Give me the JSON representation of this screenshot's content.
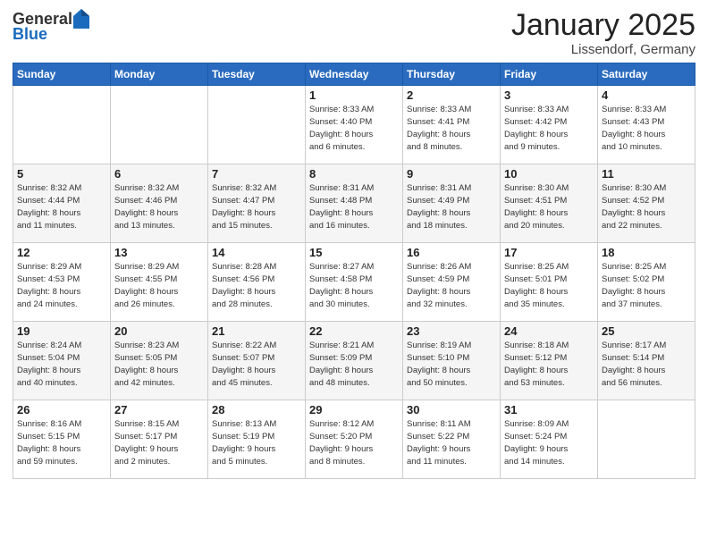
{
  "logo": {
    "general": "General",
    "blue": "Blue"
  },
  "title": "January 2025",
  "location": "Lissendorf, Germany",
  "weekdays": [
    "Sunday",
    "Monday",
    "Tuesday",
    "Wednesday",
    "Thursday",
    "Friday",
    "Saturday"
  ],
  "weeks": [
    [
      {
        "day": "",
        "info": ""
      },
      {
        "day": "",
        "info": ""
      },
      {
        "day": "",
        "info": ""
      },
      {
        "day": "1",
        "info": "Sunrise: 8:33 AM\nSunset: 4:40 PM\nDaylight: 8 hours\nand 6 minutes."
      },
      {
        "day": "2",
        "info": "Sunrise: 8:33 AM\nSunset: 4:41 PM\nDaylight: 8 hours\nand 8 minutes."
      },
      {
        "day": "3",
        "info": "Sunrise: 8:33 AM\nSunset: 4:42 PM\nDaylight: 8 hours\nand 9 minutes."
      },
      {
        "day": "4",
        "info": "Sunrise: 8:33 AM\nSunset: 4:43 PM\nDaylight: 8 hours\nand 10 minutes."
      }
    ],
    [
      {
        "day": "5",
        "info": "Sunrise: 8:32 AM\nSunset: 4:44 PM\nDaylight: 8 hours\nand 11 minutes."
      },
      {
        "day": "6",
        "info": "Sunrise: 8:32 AM\nSunset: 4:46 PM\nDaylight: 8 hours\nand 13 minutes."
      },
      {
        "day": "7",
        "info": "Sunrise: 8:32 AM\nSunset: 4:47 PM\nDaylight: 8 hours\nand 15 minutes."
      },
      {
        "day": "8",
        "info": "Sunrise: 8:31 AM\nSunset: 4:48 PM\nDaylight: 8 hours\nand 16 minutes."
      },
      {
        "day": "9",
        "info": "Sunrise: 8:31 AM\nSunset: 4:49 PM\nDaylight: 8 hours\nand 18 minutes."
      },
      {
        "day": "10",
        "info": "Sunrise: 8:30 AM\nSunset: 4:51 PM\nDaylight: 8 hours\nand 20 minutes."
      },
      {
        "day": "11",
        "info": "Sunrise: 8:30 AM\nSunset: 4:52 PM\nDaylight: 8 hours\nand 22 minutes."
      }
    ],
    [
      {
        "day": "12",
        "info": "Sunrise: 8:29 AM\nSunset: 4:53 PM\nDaylight: 8 hours\nand 24 minutes."
      },
      {
        "day": "13",
        "info": "Sunrise: 8:29 AM\nSunset: 4:55 PM\nDaylight: 8 hours\nand 26 minutes."
      },
      {
        "day": "14",
        "info": "Sunrise: 8:28 AM\nSunset: 4:56 PM\nDaylight: 8 hours\nand 28 minutes."
      },
      {
        "day": "15",
        "info": "Sunrise: 8:27 AM\nSunset: 4:58 PM\nDaylight: 8 hours\nand 30 minutes."
      },
      {
        "day": "16",
        "info": "Sunrise: 8:26 AM\nSunset: 4:59 PM\nDaylight: 8 hours\nand 32 minutes."
      },
      {
        "day": "17",
        "info": "Sunrise: 8:25 AM\nSunset: 5:01 PM\nDaylight: 8 hours\nand 35 minutes."
      },
      {
        "day": "18",
        "info": "Sunrise: 8:25 AM\nSunset: 5:02 PM\nDaylight: 8 hours\nand 37 minutes."
      }
    ],
    [
      {
        "day": "19",
        "info": "Sunrise: 8:24 AM\nSunset: 5:04 PM\nDaylight: 8 hours\nand 40 minutes."
      },
      {
        "day": "20",
        "info": "Sunrise: 8:23 AM\nSunset: 5:05 PM\nDaylight: 8 hours\nand 42 minutes."
      },
      {
        "day": "21",
        "info": "Sunrise: 8:22 AM\nSunset: 5:07 PM\nDaylight: 8 hours\nand 45 minutes."
      },
      {
        "day": "22",
        "info": "Sunrise: 8:21 AM\nSunset: 5:09 PM\nDaylight: 8 hours\nand 48 minutes."
      },
      {
        "day": "23",
        "info": "Sunrise: 8:19 AM\nSunset: 5:10 PM\nDaylight: 8 hours\nand 50 minutes."
      },
      {
        "day": "24",
        "info": "Sunrise: 8:18 AM\nSunset: 5:12 PM\nDaylight: 8 hours\nand 53 minutes."
      },
      {
        "day": "25",
        "info": "Sunrise: 8:17 AM\nSunset: 5:14 PM\nDaylight: 8 hours\nand 56 minutes."
      }
    ],
    [
      {
        "day": "26",
        "info": "Sunrise: 8:16 AM\nSunset: 5:15 PM\nDaylight: 8 hours\nand 59 minutes."
      },
      {
        "day": "27",
        "info": "Sunrise: 8:15 AM\nSunset: 5:17 PM\nDaylight: 9 hours\nand 2 minutes."
      },
      {
        "day": "28",
        "info": "Sunrise: 8:13 AM\nSunset: 5:19 PM\nDaylight: 9 hours\nand 5 minutes."
      },
      {
        "day": "29",
        "info": "Sunrise: 8:12 AM\nSunset: 5:20 PM\nDaylight: 9 hours\nand 8 minutes."
      },
      {
        "day": "30",
        "info": "Sunrise: 8:11 AM\nSunset: 5:22 PM\nDaylight: 9 hours\nand 11 minutes."
      },
      {
        "day": "31",
        "info": "Sunrise: 8:09 AM\nSunset: 5:24 PM\nDaylight: 9 hours\nand 14 minutes."
      },
      {
        "day": "",
        "info": ""
      }
    ]
  ]
}
